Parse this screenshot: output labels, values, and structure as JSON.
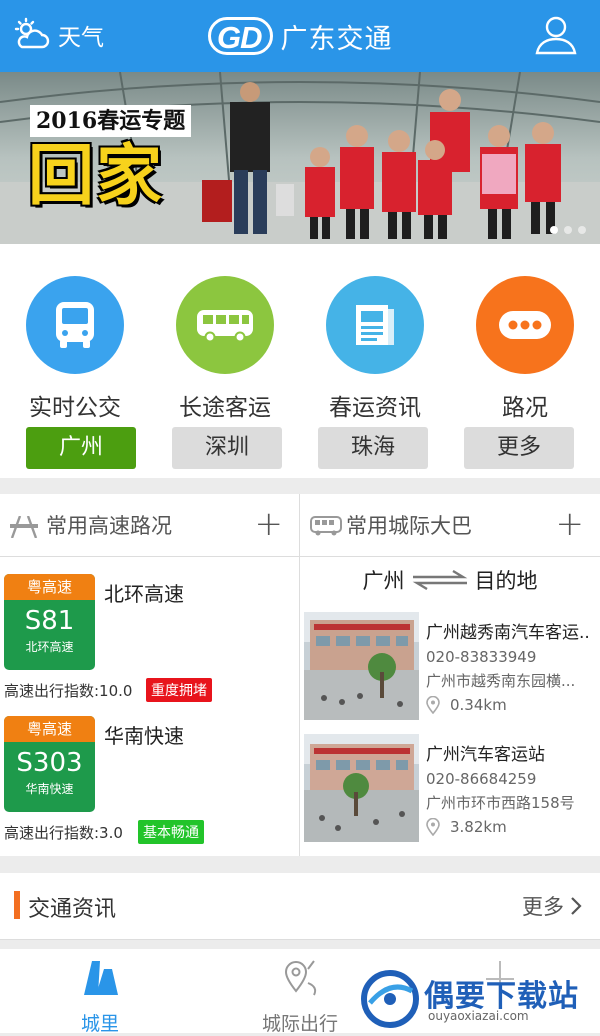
{
  "header": {
    "weather_label": "天气",
    "logo_text": "GD",
    "app_title": "广东交通"
  },
  "banner": {
    "subtitle": "2016春运专题",
    "title": "回家",
    "dots": 3,
    "active_dot": 1
  },
  "categories": [
    {
      "label": "实时公交",
      "color": "#3aa3ee",
      "icon": "bus-front-icon"
    },
    {
      "label": "长途客运",
      "color": "#8cc63f",
      "icon": "coach-bus-icon"
    },
    {
      "label": "春运资讯",
      "color": "#45b3e7",
      "icon": "newspaper-icon"
    },
    {
      "label": "路况",
      "color": "#f7731c",
      "icon": "more-dots-icon"
    }
  ],
  "cities": [
    {
      "label": "广州",
      "selected": true
    },
    {
      "label": "深圳",
      "selected": false
    },
    {
      "label": "珠海",
      "selected": false
    },
    {
      "label": "更多",
      "selected": false
    }
  ],
  "highways": {
    "title": "常用高速路况",
    "items": [
      {
        "tag": "粤高速",
        "code": "S81",
        "short_name": "北环高速",
        "name": "北环高速",
        "index_text": "高速出行指数:10.0",
        "status": "重度拥堵",
        "status_color": "#e8141c"
      },
      {
        "tag": "粤高速",
        "code": "S303",
        "short_name": "华南快速",
        "name": "华南快速",
        "index_text": "高速出行指数:3.0",
        "status": "基本畅通",
        "status_color": "#22c42a"
      }
    ]
  },
  "buses": {
    "title": "常用城际大巴",
    "from": "广州",
    "to": "目的地",
    "stations": [
      {
        "name": "广州越秀南汽车客运..",
        "phone": "020-83833949",
        "address": "广州市越秀南东园横...",
        "distance": "0.34km"
      },
      {
        "name": "广州汽车客运站",
        "phone": "020-86684259",
        "address": "广州市环市西路158号",
        "distance": "3.82km"
      }
    ]
  },
  "news": {
    "title": "交通资讯",
    "more": "更多"
  },
  "tabs": [
    {
      "label": "城里",
      "active": true
    },
    {
      "label": "城际出行",
      "active": false
    },
    {
      "label": "",
      "active": false
    }
  ],
  "watermark": {
    "text": "偶要下载站",
    "url": "ouyaoxiazai.com"
  },
  "colors": {
    "header_blue": "#2a95e8",
    "city_selected_green": "#4c9e10",
    "highway_green": "#1e9a4b",
    "highway_orange": "#f08012",
    "news_accent": "#f36f21"
  }
}
